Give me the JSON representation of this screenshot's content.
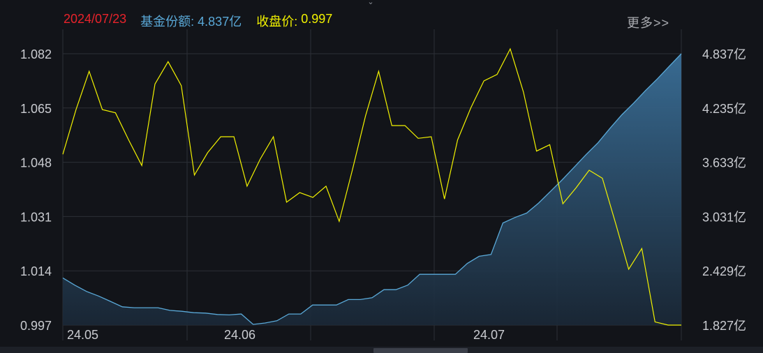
{
  "header": {
    "date": "2024/07/23",
    "fund_share_label": "基金份额:",
    "fund_share_value": "4.837亿",
    "close_price_label": "收盘价:",
    "close_price_value": "0.997",
    "more_link": "更多>>"
  },
  "colors": {
    "background": "#121419",
    "grid": "#2c2f36",
    "date": "#e8232b",
    "share": "#5aa9d8",
    "price": "#f2f200",
    "axis_text": "#c9cbd0",
    "area_top": "#3a6f98",
    "area_bottom": "#1a2837"
  },
  "chart_data": {
    "type": "line",
    "x_tick_labels": [
      "24.05",
      "24.06",
      "24.07"
    ],
    "y_left": {
      "ticks": [
        "1.082",
        "1.065",
        "1.048",
        "1.031",
        "1.014",
        "0.997"
      ],
      "ylim": [
        0.997,
        1.082
      ]
    },
    "y_right": {
      "ticks": [
        "4.837亿",
        "4.235亿",
        "3.633亿",
        "3.031亿",
        "2.429亿",
        "1.827亿"
      ],
      "ylim": [
        1.827,
        4.837
      ],
      "unit": "亿"
    },
    "series": [
      {
        "axis": "left",
        "color": "#f2f200",
        "values": [
          1.0505,
          1.0645,
          1.0765,
          1.0645,
          1.0635,
          1.055,
          1.047,
          1.0725,
          1.0795,
          1.072,
          1.044,
          1.051,
          1.056,
          1.056,
          1.0405,
          1.049,
          1.056,
          1.0355,
          1.0385,
          1.037,
          1.0405,
          1.0295,
          1.0455,
          1.0625,
          1.0765,
          1.0595,
          1.0595,
          1.0555,
          1.056,
          1.0365,
          1.055,
          1.065,
          1.0735,
          1.0755,
          1.0835,
          1.07,
          1.0515,
          1.0535,
          1.035,
          1.04,
          1.0455,
          1.043,
          1.029,
          1.0145,
          1.021,
          0.998,
          0.997,
          0.997
        ]
      },
      {
        "axis": "right",
        "color": "#5aa9d8",
        "fill": "area",
        "values": [
          2.35,
          2.27,
          2.2,
          2.15,
          2.09,
          2.03,
          2.02,
          2.02,
          2.02,
          1.99,
          1.98,
          1.965,
          1.96,
          1.945,
          1.94,
          1.95,
          1.835,
          1.85,
          1.875,
          1.95,
          1.95,
          2.05,
          2.05,
          2.05,
          2.11,
          2.11,
          2.13,
          2.22,
          2.22,
          2.27,
          2.39,
          2.39,
          2.39,
          2.39,
          2.51,
          2.59,
          2.61,
          2.96,
          3.02,
          3.07,
          3.18,
          3.31,
          3.44,
          3.58,
          3.72,
          3.85,
          4.01,
          4.16,
          4.29,
          4.43,
          4.56,
          4.7,
          4.837
        ]
      }
    ]
  }
}
